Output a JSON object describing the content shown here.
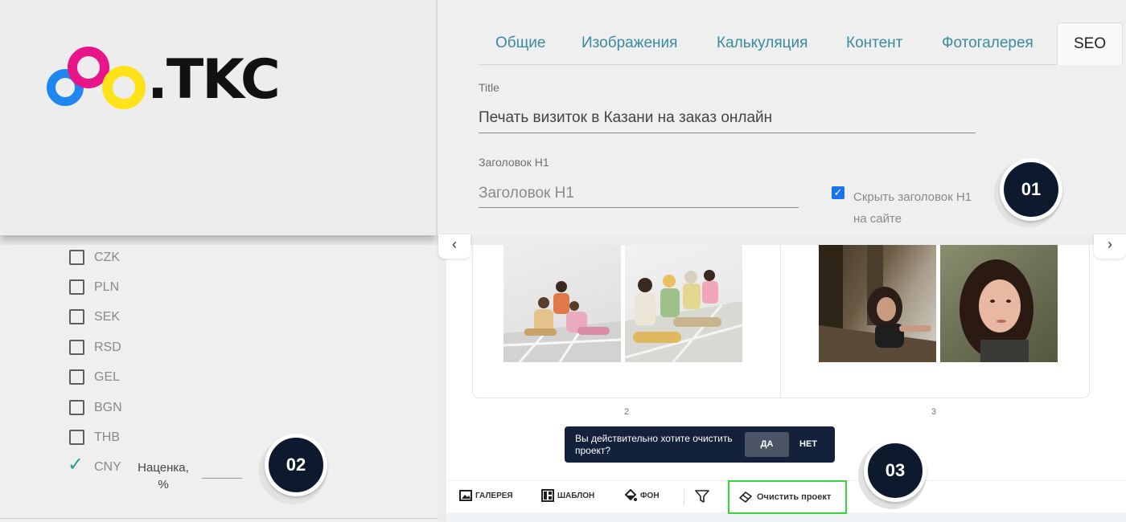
{
  "logo": {
    "text": ".TKC"
  },
  "seo_panel": {
    "tabs": [
      {
        "label": "Общие"
      },
      {
        "label": "Изображения"
      },
      {
        "label": "Калькуляция"
      },
      {
        "label": "Контент"
      },
      {
        "label": "Фотогалерея"
      },
      {
        "label": "SEO",
        "active": true
      }
    ],
    "title_label": "Title",
    "title_value": "Печать визиток в Казани на заказ онлайн",
    "h1_label": "Заголовок H1",
    "h1_placeholder": "Заголовок H1",
    "hide_h1_checked": true,
    "hide_h1_label": "Скрыть заголовок H1 на сайте"
  },
  "badges": [
    "01",
    "02",
    "03"
  ],
  "currency_list": {
    "items": [
      {
        "code": "CZK",
        "checked": false
      },
      {
        "code": "PLN",
        "checked": false
      },
      {
        "code": "SEK",
        "checked": false
      },
      {
        "code": "RSD",
        "checked": false
      },
      {
        "code": "GEL",
        "checked": false
      },
      {
        "code": "BGN",
        "checked": false
      },
      {
        "code": "THB",
        "checked": false
      },
      {
        "code": "CNY",
        "checked": true
      }
    ],
    "markup_label": "Наценка, %"
  },
  "editor": {
    "prev_icon": "chevron-left-icon",
    "next_icon": "chevron-right-icon",
    "pages": [
      "2",
      "3"
    ],
    "confirm_dialog": {
      "message": "Вы действительно хотите очистить проект?",
      "yes_label": "ДА",
      "no_label": "НЕТ"
    },
    "toolbar": {
      "gallery_label": "ГАЛЕРЕЯ",
      "template_label": "ШАБЛОН",
      "background_label": "ФОН",
      "clear_label": "Очистить проект"
    },
    "colors": {
      "highlight": "#38d43b",
      "dialog_bg": "#14213a",
      "badge_bg": "#0d1a2e"
    }
  }
}
